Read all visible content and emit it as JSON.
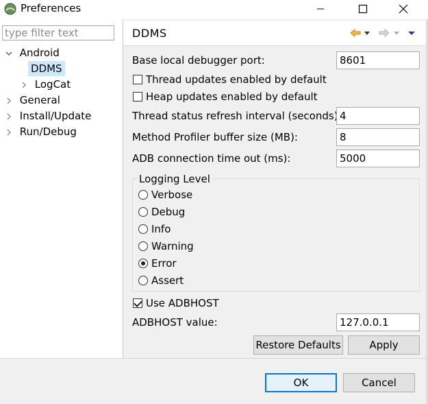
{
  "window": {
    "title": "Preferences"
  },
  "filter": {
    "placeholder": "type filter text"
  },
  "tree": [
    {
      "label": "Android",
      "expanded": true
    },
    {
      "label": "DDMS",
      "selected": true
    },
    {
      "label": "LogCat"
    },
    {
      "label": "General"
    },
    {
      "label": "Install/Update"
    },
    {
      "label": "Run/Debug"
    }
  ],
  "page": {
    "title": "DDMS",
    "fields": {
      "debugger_port": {
        "label": "Base local debugger port:",
        "value": "8601"
      },
      "thread_updates": {
        "label": "Thread updates enabled by default",
        "checked": false
      },
      "heap_updates": {
        "label": "Heap updates enabled by default",
        "checked": false
      },
      "thread_refresh": {
        "label": "Thread status refresh interval (seconds):",
        "value": "4"
      },
      "profiler_buffer": {
        "label": "Method Profiler buffer size (MB):",
        "value": "8"
      },
      "adb_timeout": {
        "label": "ADB connection time out (ms):",
        "value": "5000"
      }
    },
    "logging": {
      "legend": "Logging Level",
      "options": [
        "Verbose",
        "Debug",
        "Info",
        "Warning",
        "Error",
        "Assert"
      ],
      "selected": "Error"
    },
    "adbhost": {
      "use_label": "Use ADBHOST",
      "use_checked": true,
      "value_label": "ADBHOST value:",
      "value": "127.0.0.1"
    }
  },
  "buttons": {
    "restore": "Restore Defaults",
    "apply": "Apply",
    "ok": "OK",
    "cancel": "Cancel"
  },
  "colors": {
    "selection": "#cce8ff",
    "accent": "#0078d7",
    "nav_arrow": "#f0a030"
  }
}
